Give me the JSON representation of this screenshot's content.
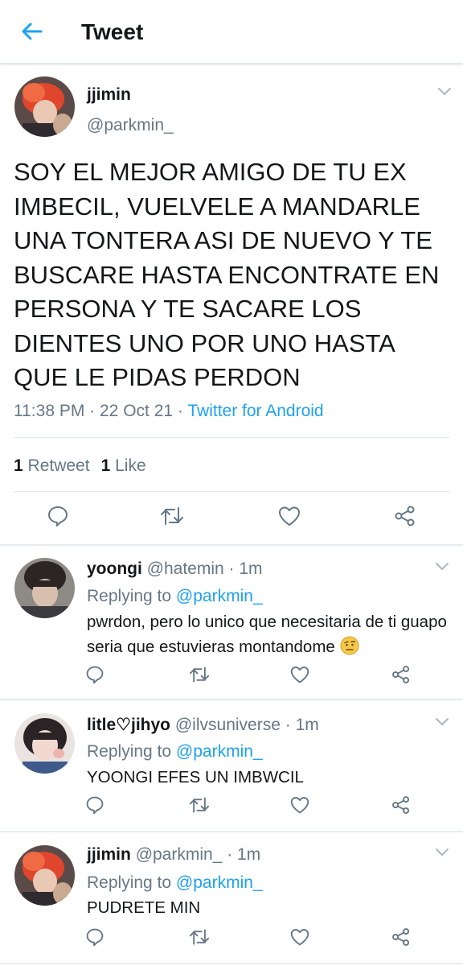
{
  "header": {
    "title": "Tweet",
    "back_icon": "arrow-left-icon"
  },
  "tweet": {
    "name": "jjimin",
    "handle": "@parkmin_",
    "text": "SOY EL MEJOR AMIGO DE TU EX IMBECIL, VUELVELE A MANDARLE UNA TONTERA ASI DE NUEVO Y TE BUSCARE HASTA ENCONTRATE EN PERSONA Y TE SACARE LOS DIENTES UNO POR UNO HASTA QUE LE PIDAS PERDON",
    "time": "11:38 PM",
    "sep": " · ",
    "date": "22 Oct 21",
    "source": "Twitter for Android",
    "retweets_count": "1",
    "retweets_label": "Retweet",
    "likes_count": "1",
    "likes_label": "Like"
  },
  "replies": [
    {
      "name": "yoongi",
      "handle": "@hatemin",
      "time": "1m",
      "replying_prefix": "Replying to ",
      "replying_to": "@parkmin_",
      "text": "pwrdon, pero lo unico que necesitaria de ti guapo seria que estuvieras montandome",
      "emoji": "face-with-raised-eyebrow-emoji"
    },
    {
      "name": "litle♡jihyo",
      "handle": "@ilvsuniverse",
      "time": "1m",
      "replying_prefix": "Replying to ",
      "replying_to": "@parkmin_",
      "text": "YOONGI EFES UN IMBWCIL"
    },
    {
      "name": "jjimin",
      "handle": "@parkmin_",
      "time": "1m",
      "replying_prefix": "Replying to ",
      "replying_to": "@parkmin_",
      "text": "PUDRETE MIN"
    }
  ],
  "dot_sep": " · ",
  "icons": [
    "arrow-left-icon",
    "chevron-down-icon",
    "reply-icon",
    "retweet-icon",
    "like-icon",
    "share-icon"
  ],
  "colors": {
    "accent": "#1da1f2",
    "secondary_text": "#657786",
    "divider": "#e1e8ed"
  }
}
